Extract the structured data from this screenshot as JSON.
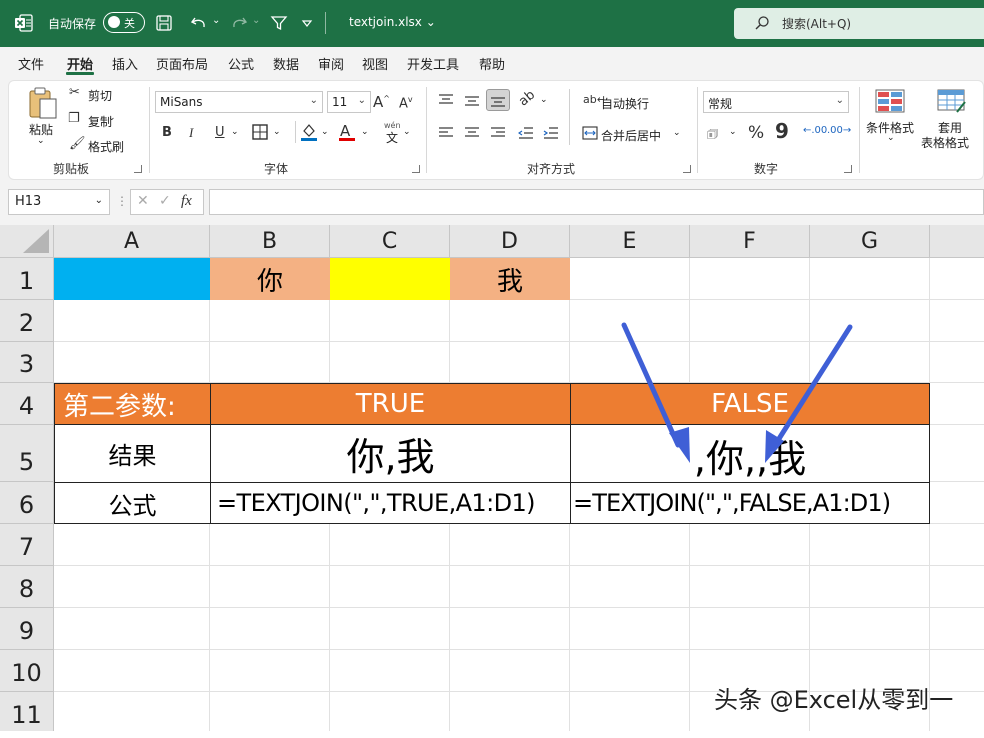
{
  "titlebar": {
    "autosave_label": "自动保存",
    "autosave_state": "关",
    "filename": "textjoin.xlsx",
    "filename_arrow": "⌄",
    "search_placeholder": "搜索(Alt+Q)",
    "bg_color": "#1e7145"
  },
  "menu": {
    "items": [
      "文件",
      "开始",
      "插入",
      "页面布局",
      "公式",
      "数据",
      "审阅",
      "视图",
      "开发工具",
      "帮助"
    ],
    "active": "开始"
  },
  "ribbon": {
    "clipboard": {
      "paste": "粘贴",
      "cut": "剪切",
      "copy": "复制",
      "format_painter": "格式刷",
      "label": "剪贴板"
    },
    "font": {
      "font_name": "MiSans",
      "font_size": "11",
      "bold": "B",
      "italic": "I",
      "underline": "U",
      "label": "字体",
      "phonetic": "wén"
    },
    "alignment": {
      "wrap_text": "自动换行",
      "merge_center": "合并后居中",
      "label": "对齐方式"
    },
    "number": {
      "format": "常规",
      "label": "数字",
      "percent": "%",
      "comma": "9"
    },
    "styles": {
      "conditional_format": "条件格式",
      "format_as_table_line1": "套用",
      "format_as_table_line2": "表格格式"
    }
  },
  "formula_bar": {
    "name_box": "H13",
    "fx": "fx",
    "formula": ""
  },
  "grid": {
    "columns": [
      "A",
      "B",
      "C",
      "D",
      "E",
      "F",
      "G"
    ],
    "rows": [
      "1",
      "2",
      "3",
      "4",
      "5",
      "6",
      "7",
      "8",
      "9",
      "10",
      "11"
    ],
    "row1": {
      "B1": "你",
      "D1": "我"
    },
    "row1_colors": {
      "A1": "#00b0f0",
      "B1": "#f4b183",
      "C1": "#ffff00",
      "D1": "#f4b183"
    },
    "table": {
      "header_label": "第二参数:",
      "header_true": "TRUE",
      "header_false": "FALSE",
      "result_label": "结果",
      "result_true": "你,我",
      "result_false": ",你,,我",
      "formula_label": "公式",
      "formula_true": "=TEXTJOIN(\",\",TRUE,A1:D1)",
      "formula_false": "=TEXTJOIN(\",\",FALSE,A1:D1)",
      "header_color": "#ed7d31"
    }
  },
  "annotation": {
    "arrow_color": "#3f5fd6"
  },
  "watermark": "头条 @Excel从零到一"
}
